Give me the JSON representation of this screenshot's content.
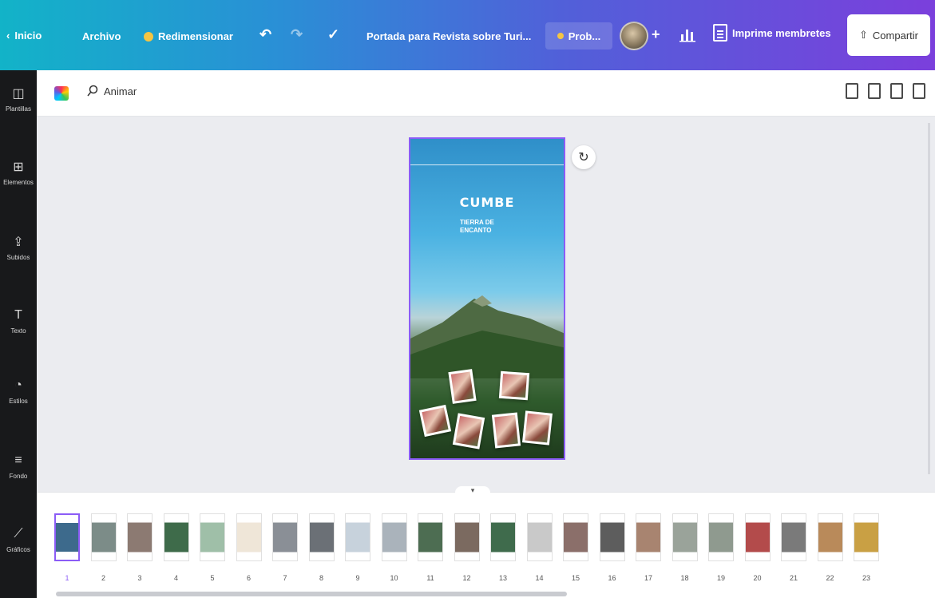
{
  "topbar": {
    "back_label": "Inicio",
    "file_label": "Archivo",
    "resize_label": "Redimensionar",
    "undo_icon": "undo-icon",
    "redo_icon": "redo-icon",
    "saved_icon": "cloud-check-icon",
    "doc_title": "Portada para Revista sobre Turi...",
    "pro_label": "Prob...",
    "plus_label": "+",
    "print_label": "Imprime membretes",
    "share_label": "Compartir"
  },
  "sidebar": {
    "items": [
      {
        "label": "Plantillas",
        "icon": "templates-icon",
        "glyph": "◫"
      },
      {
        "label": "Elementos",
        "icon": "elements-icon",
        "glyph": "⊞"
      },
      {
        "label": "Subidos",
        "icon": "upload-icon",
        "glyph": "⇪"
      },
      {
        "label": "Texto",
        "icon": "text-icon",
        "glyph": "T"
      },
      {
        "label": "Estilos",
        "icon": "styles-icon",
        "glyph": "◔"
      },
      {
        "label": "Fondo",
        "icon": "background-icon",
        "glyph": "≡"
      },
      {
        "label": "Gráficos",
        "icon": "charts-icon",
        "glyph": "⟋"
      }
    ]
  },
  "editor": {
    "animate_label": "Animar"
  },
  "canvas": {
    "cover_title": "CUMBE",
    "cover_subtitle": "TIERRA DE ENCANTO"
  },
  "pages": {
    "numbers": [
      "1",
      "2",
      "3",
      "4",
      "5",
      "6",
      "7",
      "8",
      "9",
      "10",
      "11",
      "12",
      "13",
      "14",
      "15",
      "16",
      "17",
      "18",
      "19",
      "20",
      "21",
      "22",
      "23"
    ],
    "selected": "1",
    "toggle_glyph": "▾"
  },
  "colors": {
    "accent": "#8b5cf6",
    "gradient_start": "#12b3c8",
    "gradient_end": "#7b3fdc"
  }
}
